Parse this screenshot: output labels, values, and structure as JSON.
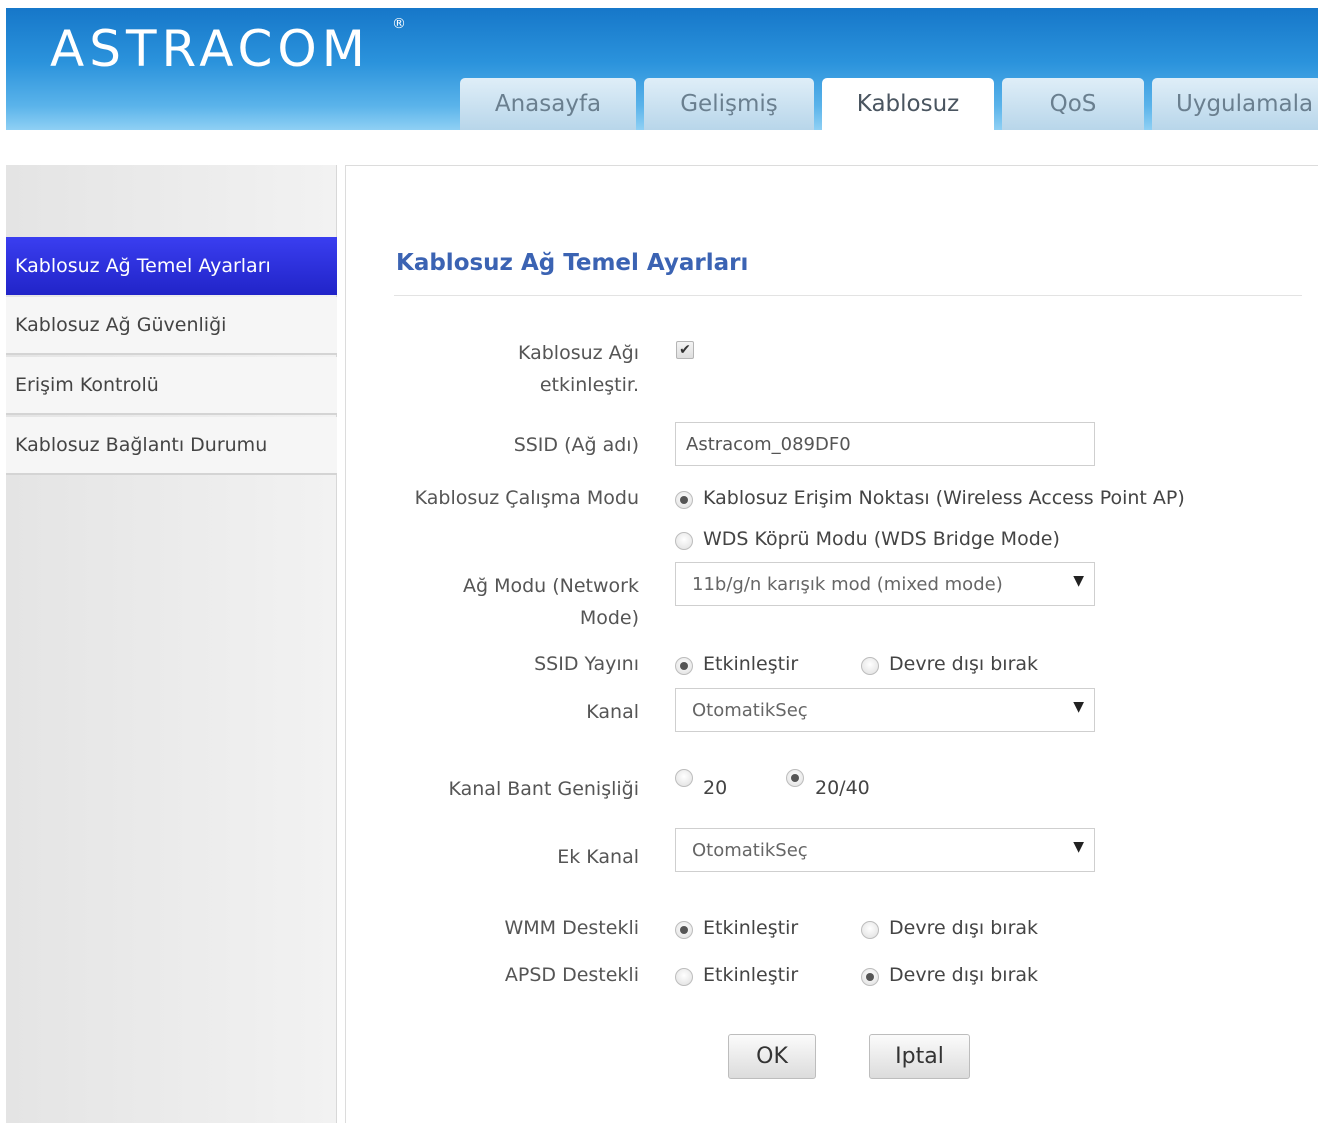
{
  "header": {
    "logo": "ASTRACOM",
    "logo_mark": "®",
    "tabs": [
      {
        "label": "Anasayfa"
      },
      {
        "label": "Gelişmiş"
      },
      {
        "label": "Kablosuz",
        "active": true
      },
      {
        "label": "QoS"
      },
      {
        "label": "Uygulamala"
      }
    ]
  },
  "sidebar": {
    "items": [
      {
        "label": "Kablosuz Ağ Temel Ayarları",
        "active": true
      },
      {
        "label": "Kablosuz Ağ Güvenliği"
      },
      {
        "label": "Erişim Kontrolü"
      },
      {
        "label": "Kablosuz Bağlantı Durumu"
      }
    ]
  },
  "main": {
    "title": "Kablosuz Ağ Temel Ayarları",
    "enable_wireless": {
      "label_line1": "Kablosuz Ağı",
      "label_line2": "etkinleştir.",
      "checked": true,
      "check_glyph": "✔"
    },
    "ssid": {
      "label": "SSID (Ağ adı)",
      "value": "Astracom_089DF0"
    },
    "work_mode": {
      "label": "Kablosuz Çalışma Modu",
      "options": [
        {
          "label": "Kablosuz Erişim Noktası (Wireless Access Point AP)",
          "selected": true
        },
        {
          "label": "WDS Köprü Modu (WDS Bridge Mode)",
          "selected": false
        }
      ]
    },
    "network_mode": {
      "label_line1": "Ağ Modu (Network",
      "label_line2": "Mode)",
      "value": "11b/g/n karışık mod (mixed mode)"
    },
    "ssid_broadcast": {
      "label": "SSID Yayını",
      "options": [
        {
          "label": "Etkinleştir",
          "selected": true
        },
        {
          "label": "Devre dışı bırak",
          "selected": false
        }
      ]
    },
    "channel": {
      "label": "Kanal",
      "value": "OtomatikSeç"
    },
    "bandwidth": {
      "label": "Kanal Bant Genişliği",
      "options": [
        {
          "label": "20",
          "selected": false
        },
        {
          "label": "20/40",
          "selected": true
        }
      ]
    },
    "ext_channel": {
      "label": "Ek Kanal",
      "value": "OtomatikSeç"
    },
    "wmm": {
      "label": "WMM Destekli",
      "options": [
        {
          "label": "Etkinleştir",
          "selected": true
        },
        {
          "label": "Devre dışı bırak",
          "selected": false
        }
      ]
    },
    "apsd": {
      "label": "APSD Destekli",
      "options": [
        {
          "label": "Etkinleştir",
          "selected": false
        },
        {
          "label": "Devre dışı bırak",
          "selected": true
        }
      ]
    },
    "buttons": {
      "ok": "OK",
      "cancel": "Iptal"
    },
    "select_arrow": "▼"
  }
}
